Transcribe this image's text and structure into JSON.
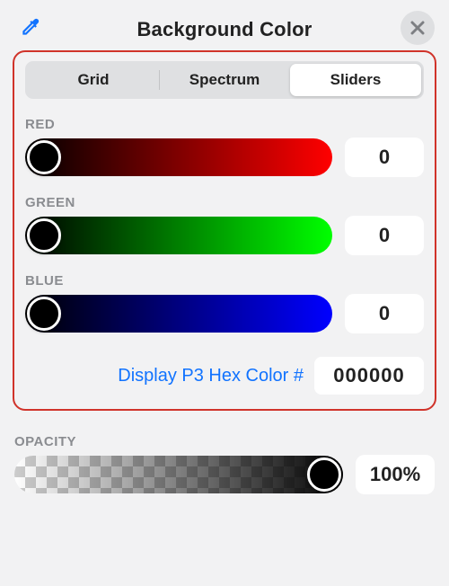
{
  "header": {
    "title": "Background Color"
  },
  "tabs": [
    {
      "label": "Grid",
      "selected": false
    },
    {
      "label": "Spectrum",
      "selected": false
    },
    {
      "label": "Sliders",
      "selected": true
    }
  ],
  "channels": {
    "red": {
      "label": "RED",
      "value": "0"
    },
    "green": {
      "label": "GREEN",
      "value": "0"
    },
    "blue": {
      "label": "BLUE",
      "value": "0"
    }
  },
  "hex": {
    "link_text": "Display P3 Hex Color #",
    "value": "000000"
  },
  "opacity": {
    "label": "OPACITY",
    "value": "100%"
  }
}
